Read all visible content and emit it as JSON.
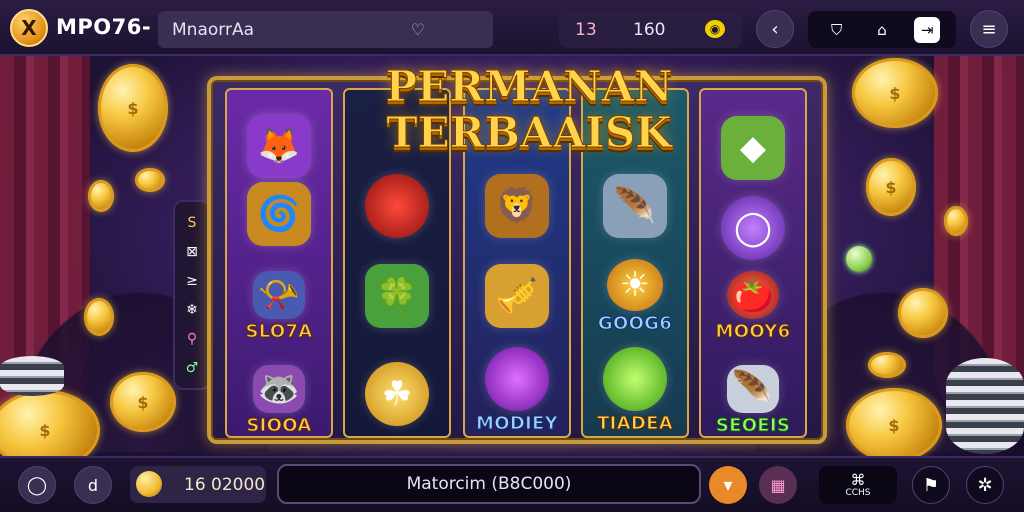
{
  "topbar": {
    "logo_glyph": "X",
    "brand": "MPO76-",
    "search_value": "MnaorrAa",
    "search_icon": "heartbeat-icon",
    "stat_a": "13",
    "stat_b": "160",
    "icons": [
      "back-arrow-icon",
      "bag-icon",
      "home-icon",
      "exit-icon",
      "menu-icon"
    ]
  },
  "title": {
    "line1": "PERMANAN",
    "line2": "TERBAAISK"
  },
  "reels": [
    {
      "cells": [
        {
          "symbol": "fox-icon",
          "label": ""
        },
        {
          "symbol": "gold-scroll-icon",
          "label": ""
        },
        {
          "symbol": "horn-icon",
          "label": "SLO7A"
        },
        {
          "symbol": "raccoon-icon",
          "label": "SIOOA"
        }
      ]
    },
    {
      "cells": [
        {
          "symbol": "red-orb-icon",
          "label": ""
        },
        {
          "symbol": "emerald-box-icon",
          "label": ""
        },
        {
          "symbol": "clover-coin-icon",
          "label": ""
        }
      ]
    },
    {
      "cells": [
        {
          "symbol": "lion-mask-icon",
          "label": ""
        },
        {
          "symbol": "golden-cannon-icon",
          "label": ""
        },
        {
          "symbol": "purple-bomb-icon",
          "label": "MODIEY"
        }
      ]
    },
    {
      "cells": [
        {
          "symbol": "feather-icon",
          "label": ""
        },
        {
          "symbol": "sun-face-icon",
          "label": "GOOG6"
        },
        {
          "symbol": "green-orb-icon",
          "label": "TIADEA"
        }
      ]
    },
    {
      "cells": [
        {
          "symbol": "green-gem-box-icon",
          "label": ""
        },
        {
          "symbol": "purple-ring-icon",
          "label": ""
        },
        {
          "symbol": "tomato-icon",
          "label": "MOOY6"
        },
        {
          "symbol": "silver-feather-icon",
          "label": "SEOEIS"
        }
      ]
    }
  ],
  "side_strip": [
    "S",
    "⊠",
    "≥",
    "❄",
    "⚲",
    "♂"
  ],
  "bottombar": {
    "bet_value": "16 02000",
    "message": "Matorcim (B8C000)",
    "left_glyph": "d",
    "cb_label": "CCHS"
  },
  "colors": {
    "accent_gold": "#f7c740",
    "accent_orange": "#e88a2a",
    "bar_bg": "#1b1230"
  }
}
